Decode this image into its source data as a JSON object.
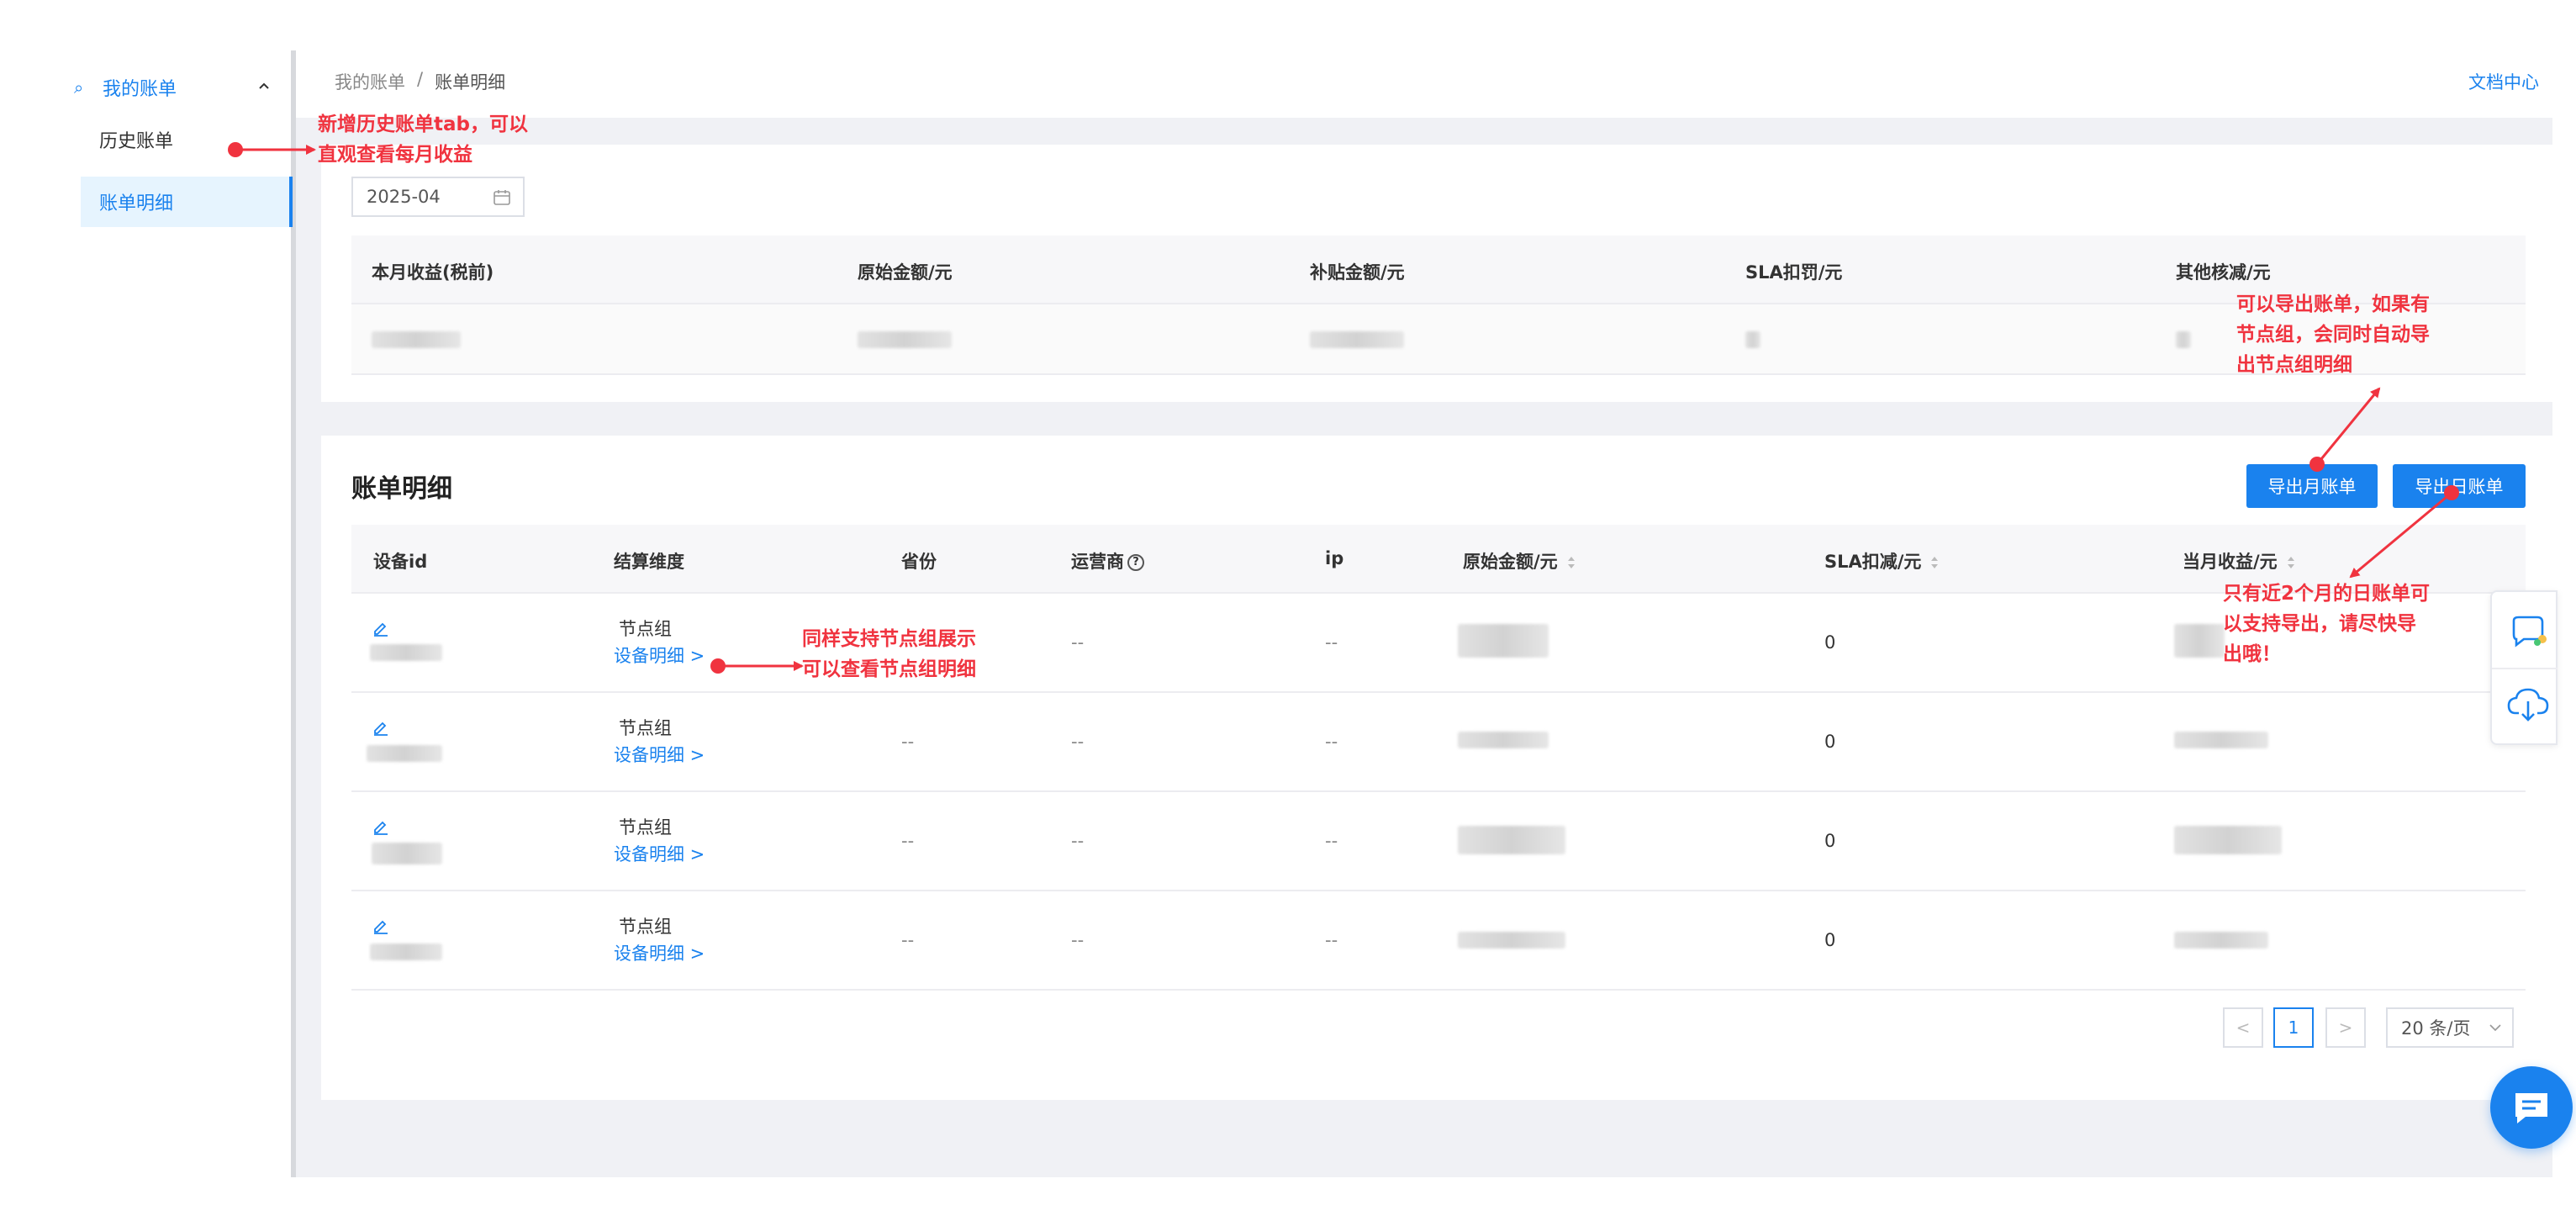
{
  "sidebar": {
    "parent_label": "我的账单",
    "items": [
      {
        "label": "历史账单"
      },
      {
        "label": "账单明细"
      }
    ]
  },
  "header": {
    "breadcrumb": [
      "我的账单",
      "/",
      "账单明细"
    ],
    "doc_link": "文档中心"
  },
  "summary": {
    "date": "2025-04",
    "columns": [
      "本月收益(税前)",
      "原始金额/元",
      "补贴金额/元",
      "SLA扣罚/元",
      "其他核减/元"
    ]
  },
  "detail": {
    "title": "账单明细",
    "export_monthly": "导出月账单",
    "export_daily": "导出日账单",
    "columns": [
      "设备id",
      "结算维度",
      "省份",
      "运营商",
      "ip",
      "原始金额/元",
      "SLA扣减/元",
      "当月收益/元"
    ],
    "help_mark": "?",
    "rows": [
      {
        "dimension": "节点组",
        "detail_link": "设备明细 >",
        "province": "",
        "isp": "--",
        "ip": "--",
        "sla": "0"
      },
      {
        "dimension": "节点组",
        "detail_link": "设备明细 >",
        "province": "--",
        "isp": "--",
        "ip": "--",
        "sla": "0"
      },
      {
        "dimension": "节点组",
        "detail_link": "设备明细 >",
        "province": "--",
        "isp": "--",
        "ip": "--",
        "sla": "0"
      },
      {
        "dimension": "节点组",
        "detail_link": "设备明细 >",
        "province": "--",
        "isp": "--",
        "ip": "--",
        "sla": "0"
      }
    ]
  },
  "pagination": {
    "prev": "<",
    "page": "1",
    "next": ">",
    "page_size": "20 条/页"
  },
  "annotations": {
    "history_tab": [
      "新增历史账单tab，可以",
      "直观查看每月收益"
    ],
    "node_group": [
      "同样支持节点组展示",
      "可以查看节点组明细"
    ],
    "export_monthly": [
      "可以导出账单，如果有",
      "节点组，会同时自动导",
      "出节点组明细"
    ],
    "export_daily": [
      "只有近2个月的日账单可",
      "以支持导出，请尽快导",
      "出哦！"
    ]
  },
  "colors": {
    "accent": "#1a82ee",
    "annotation": "#f0333f",
    "background_gray": "#f0f1f5"
  }
}
